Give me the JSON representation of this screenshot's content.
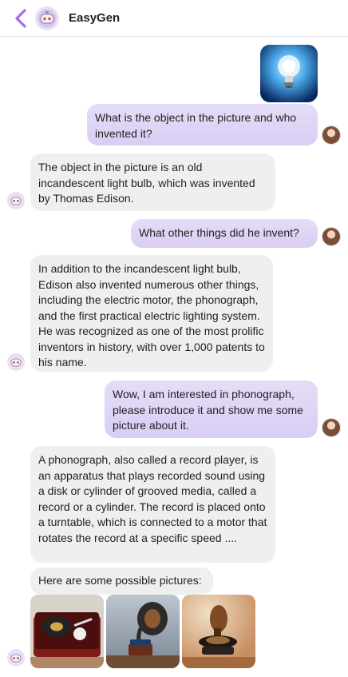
{
  "app": {
    "title": "EasyGen"
  },
  "icons": {
    "back": "back-arrow-icon",
    "bot_avatar": "robot-avatar-icon",
    "user_avatar": "user-avatar-icon"
  },
  "colors": {
    "back_arrow": "#a56be8",
    "user_bubble": "#ddd2f5",
    "bot_bubble": "#efefef"
  },
  "conversation": {
    "user_message_1": "What is the object in the picture and who invented it?",
    "bot_message_1": "The object in the picture is an old incandescent light bulb, which was invented by Thomas Edison.",
    "user_message_2": "What other things did he invent?",
    "bot_message_2": "In addition to the incandescent light bulb, Edison also invented numerous other things, including the electric motor, the phonograph, and the first practical electric lighting system. He was recognized as one of the most prolific inventors in history, with over 1,000 patents to his name.",
    "user_message_3": "Wow, I am interested in phonograph, please introduce it and show me some picture about it.",
    "bot_message_3": "A phonograph, also called a record player, is an apparatus that plays recorded sound using a disk or cylinder of grooved media, called a record or a cylinder. The record is placed onto a turntable, which is connected to a motor that rotates the record at a specific speed ....",
    "bot_message_4": "Here are some possible pictures:"
  }
}
